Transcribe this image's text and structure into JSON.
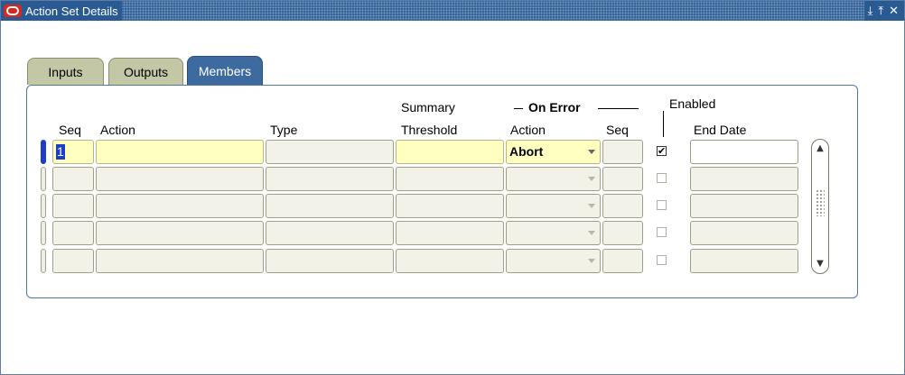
{
  "window": {
    "title": "Action Set Details",
    "controls": [
      "minimize-icon",
      "maximize-icon",
      "close-icon"
    ]
  },
  "titlebar_buttons": {
    "minimize": "⤓",
    "maximize": "⤒",
    "close": "✕"
  },
  "tabs": [
    {
      "label": "Inputs",
      "active": false
    },
    {
      "label": "Outputs",
      "active": false
    },
    {
      "label": "Members",
      "active": true
    }
  ],
  "columns": {
    "seq": "Seq",
    "action": "Action",
    "type": "Type",
    "summary_threshold_top": "Summary",
    "summary_threshold_bottom": "Threshold",
    "on_error_group": "On Error",
    "on_error_action": "Action",
    "on_error_seq": "Seq",
    "enabled": "Enabled",
    "end_date": "End Date"
  },
  "rows": [
    {
      "seq": "1",
      "action": "",
      "type": "",
      "threshold": "",
      "on_error_action": "Abort",
      "on_error_seq": "",
      "enabled": true,
      "end_date": ""
    },
    {
      "seq": "",
      "action": "",
      "type": "",
      "threshold": "",
      "on_error_action": "",
      "on_error_seq": "",
      "enabled": false,
      "end_date": ""
    },
    {
      "seq": "",
      "action": "",
      "type": "",
      "threshold": "",
      "on_error_action": "",
      "on_error_seq": "",
      "enabled": false,
      "end_date": ""
    },
    {
      "seq": "",
      "action": "",
      "type": "",
      "threshold": "",
      "on_error_action": "",
      "on_error_seq": "",
      "enabled": false,
      "end_date": ""
    },
    {
      "seq": "",
      "action": "",
      "type": "",
      "threshold": "",
      "on_error_action": "",
      "on_error_seq": "",
      "enabled": false,
      "end_date": ""
    }
  ],
  "checkmark": "✔",
  "colors": {
    "titlebar": "#2a5a92",
    "active_tab": "#3d6b9f",
    "inactive_tab": "#c3c7a6",
    "required_field": "#ffffc0",
    "selection": "#1b3fc9"
  }
}
